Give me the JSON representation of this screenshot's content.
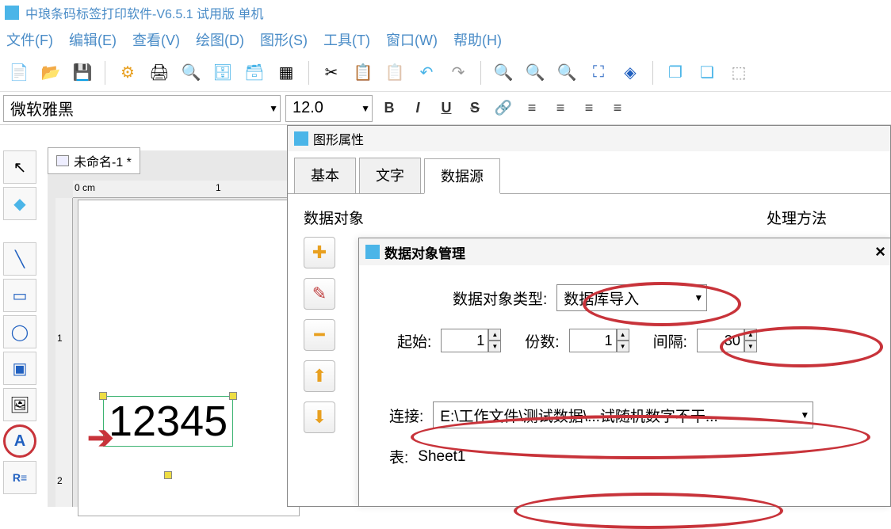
{
  "app": {
    "title": "中琅条码标签打印软件-V6.5.1 试用版 单机"
  },
  "menu": {
    "file": "文件(F)",
    "edit": "编辑(E)",
    "view": "查看(V)",
    "draw": "绘图(D)",
    "shape": "图形(S)",
    "tool": "工具(T)",
    "window": "窗口(W)",
    "help": "帮助(H)"
  },
  "fontbar": {
    "font_name": "微软雅黑",
    "font_size": "12.0"
  },
  "doc": {
    "tab_name": "未命名-1 *"
  },
  "ruler": {
    "unit": "0 cm",
    "tick1": "1",
    "tickV1": "1",
    "tickV2": "2"
  },
  "canvas": {
    "text_sample": "12345"
  },
  "dlg1": {
    "title": "图形属性",
    "tab_basic": "基本",
    "tab_text": "文字",
    "tab_datasource": "数据源",
    "label_data_object": "数据对象",
    "label_process": "处理方法"
  },
  "dlg2": {
    "title": "数据对象管理",
    "label_type": "数据对象类型:",
    "type_value": "数据库导入",
    "label_start": "起始:",
    "start_value": "1",
    "label_count": "份数:",
    "count_value": "1",
    "label_interval": "间隔:",
    "interval_value": "30",
    "label_conn": "连接:",
    "conn_value": "E:\\工作文件\\测试数据\\...试随机数字不干...",
    "label_sheet": "表:",
    "sheet_value": "Sheet1"
  }
}
